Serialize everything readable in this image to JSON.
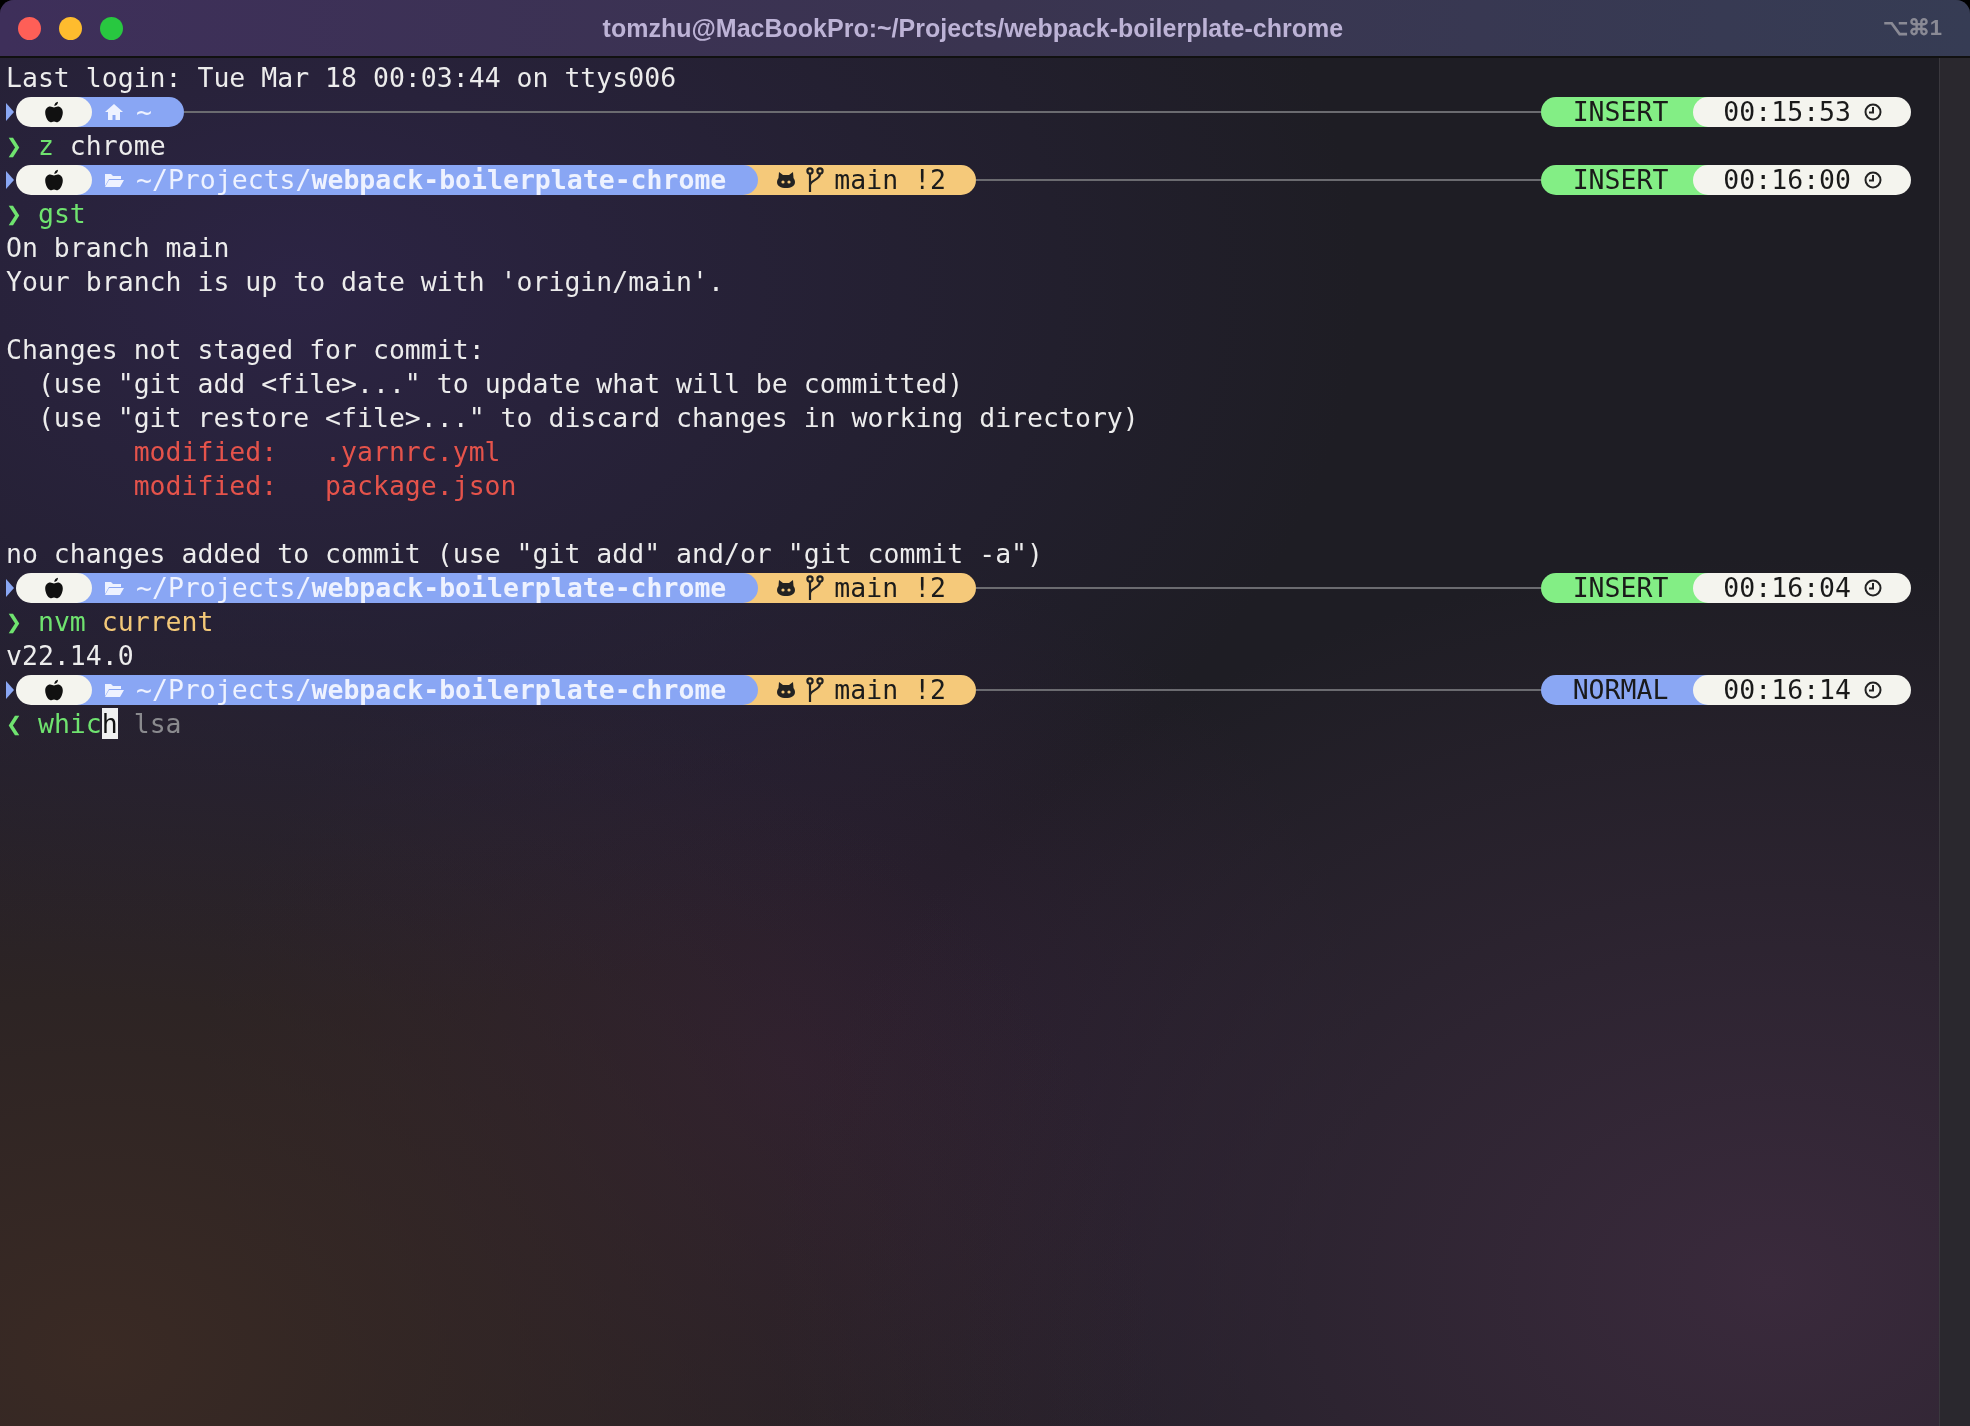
{
  "window": {
    "title": "tomzhu@MacBookPro:~/Projects/webpack-boilerplate-chrome",
    "shortcut": "⌥⌘1"
  },
  "lines": [
    {
      "kind": "output",
      "text": "Last login: Tue Mar 18 00:03:44 on ttys006"
    },
    {
      "kind": "prompt",
      "location": {
        "kind": "home",
        "path": "~"
      },
      "mode": {
        "label": "INSERT",
        "kind": "insert"
      },
      "time": "00:15:53"
    },
    {
      "kind": "command",
      "symbol": "❯",
      "parts": [
        {
          "kind": "command",
          "text": "z"
        },
        {
          "kind": "arg",
          "text": " chrome"
        }
      ]
    },
    {
      "kind": "prompt",
      "location": {
        "kind": "folder",
        "path": "~/Projects/**webpack-boilerplate-chrome**"
      },
      "git": {
        "branch": "main",
        "status": "!2"
      },
      "mode": {
        "label": "INSERT",
        "kind": "insert"
      },
      "time": "00:16:00"
    },
    {
      "kind": "command",
      "symbol": "❯",
      "parts": [
        {
          "kind": "command",
          "text": "gst"
        }
      ]
    },
    {
      "kind": "output",
      "text": "On branch main"
    },
    {
      "kind": "output",
      "text": "Your branch is up to date with 'origin/main'."
    },
    {
      "kind": "blank"
    },
    {
      "kind": "output",
      "text": "Changes not staged for commit:"
    },
    {
      "kind": "output",
      "text": "  (use \"git add <file>...\" to update what will be committed)"
    },
    {
      "kind": "output",
      "text": "  (use \"git restore <file>...\" to discard changes in working directory)"
    },
    {
      "kind": "modified",
      "label": "modified:",
      "file": ".yarnrc.yml"
    },
    {
      "kind": "modified",
      "label": "modified:",
      "file": "package.json"
    },
    {
      "kind": "blank"
    },
    {
      "kind": "output",
      "text": "no changes added to commit (use \"git add\" and/or \"git commit -a\")"
    },
    {
      "kind": "prompt",
      "location": {
        "kind": "folder",
        "path": "~/Projects/**webpack-boilerplate-chrome**"
      },
      "git": {
        "branch": "main",
        "status": "!2"
      },
      "mode": {
        "label": "INSERT",
        "kind": "insert"
      },
      "time": "00:16:04"
    },
    {
      "kind": "command",
      "symbol": "❯",
      "parts": [
        {
          "kind": "command",
          "text": "nvm"
        },
        {
          "kind": "string",
          "text": " current"
        }
      ]
    },
    {
      "kind": "output",
      "text": "v22.14.0"
    },
    {
      "kind": "prompt",
      "location": {
        "kind": "folder",
        "path": "~/Projects/**webpack-boilerplate-chrome**"
      },
      "git": {
        "branch": "main",
        "status": "!2"
      },
      "mode": {
        "label": "NORMAL",
        "kind": "normal"
      },
      "time": "00:16:14"
    },
    {
      "kind": "command",
      "symbol": "❮",
      "parts": [
        {
          "kind": "command",
          "text": "whic"
        },
        {
          "kind": "cursor",
          "text": "h"
        },
        {
          "kind": "suggestion",
          "text": " lsa"
        }
      ]
    }
  ]
}
